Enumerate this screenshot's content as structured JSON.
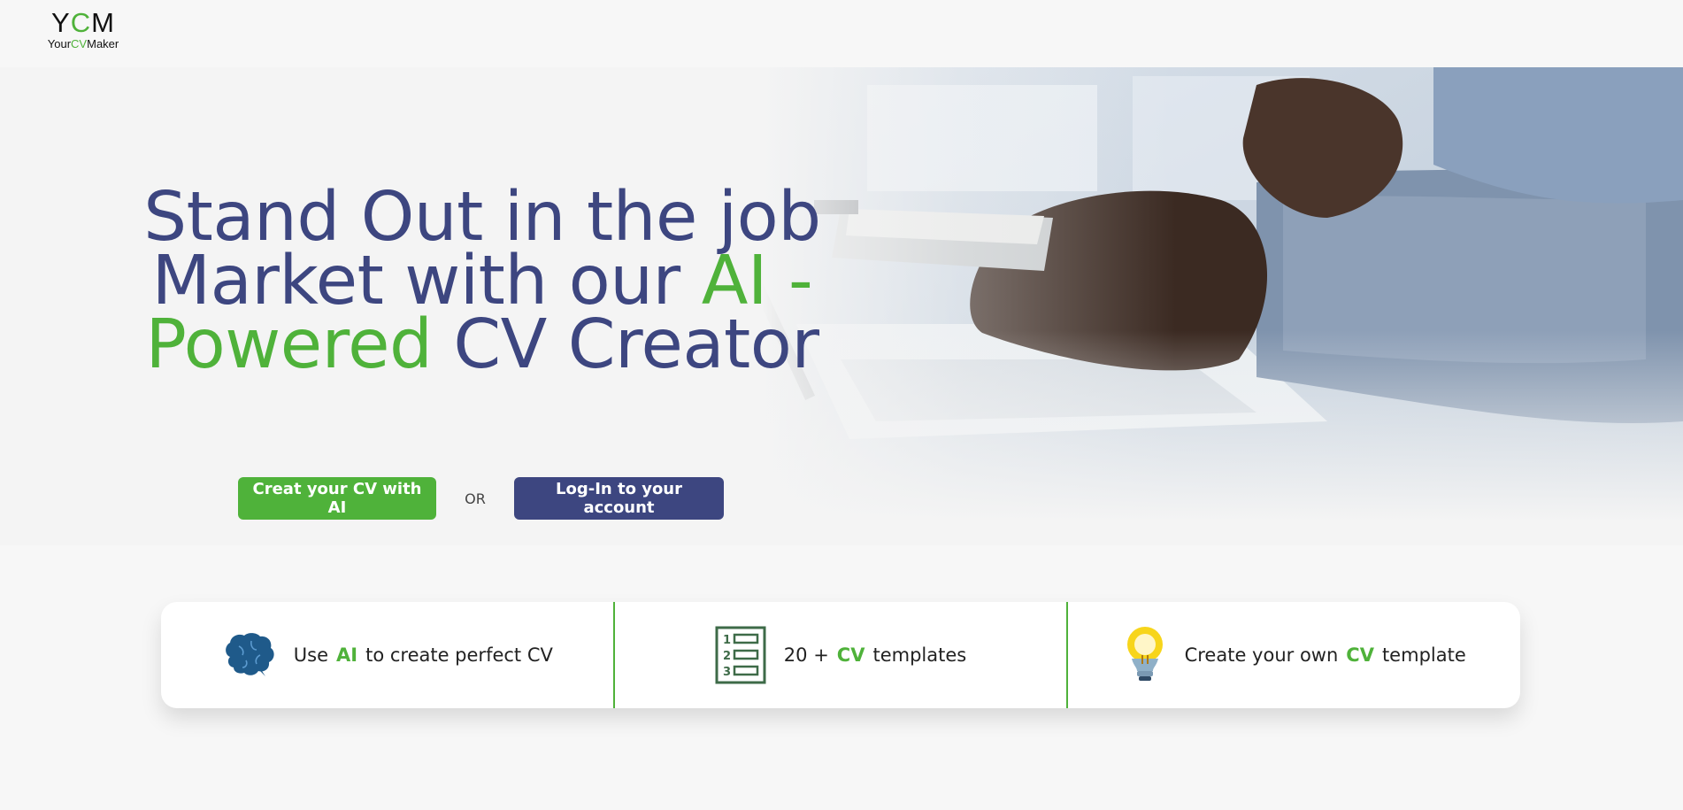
{
  "logo": {
    "mark_y": "Y",
    "mark_c": "C",
    "mark_m": "M",
    "sub_your": "Your",
    "sub_cv": "CV",
    "sub_maker": "Maker"
  },
  "hero": {
    "headline_part1": "Stand Out in the job Market with our ",
    "headline_highlight": "AI - Powered",
    "headline_part2": " CV Creator",
    "cta_primary": "Creat your CV with AI",
    "or_text": "OR",
    "cta_secondary": "Log-In to your account"
  },
  "features": [
    {
      "before": "Use",
      "accent": "AI",
      "after": "to create perfect CV",
      "icon": "brain-icon"
    },
    {
      "before": "20 +",
      "accent": "CV",
      "after": "templates",
      "icon": "numbered-list-icon"
    },
    {
      "before": "Create your own",
      "accent": "CV",
      "after": "template",
      "icon": "lightbulb-icon"
    }
  ],
  "colors": {
    "brand_green": "#4fb23a",
    "brand_navy": "#3d4680",
    "background": "#f7f7f7"
  }
}
